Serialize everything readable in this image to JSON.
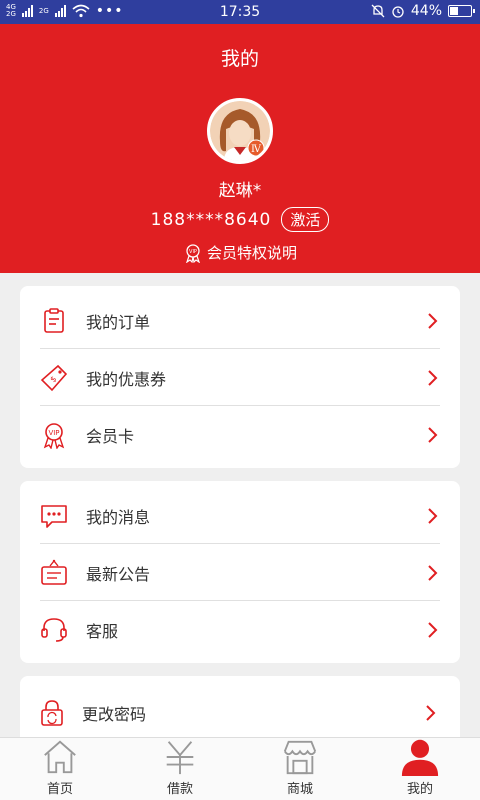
{
  "status_bar": {
    "net1": "4G",
    "net2": "2G",
    "net3": "2G",
    "time": "17:35",
    "battery": "44%",
    "battery_level": 0.44
  },
  "header": {
    "title": "我的",
    "name": "赵琳*",
    "phone": "188****8640",
    "activate_label": "激活",
    "privilege_label": "会员特权说明"
  },
  "group1": [
    {
      "label": "我的订单",
      "icon": "clipboard-icon"
    },
    {
      "label": "我的优惠券",
      "icon": "coupon-tag-icon"
    },
    {
      "label": "会员卡",
      "icon": "vip-badge-icon"
    }
  ],
  "group2": [
    {
      "label": "我的消息",
      "icon": "message-icon"
    },
    {
      "label": "最新公告",
      "icon": "notice-board-icon"
    },
    {
      "label": "客服",
      "icon": "headset-icon"
    }
  ],
  "group3": [
    {
      "label": "更改密码",
      "icon": "lock-refresh-icon"
    }
  ],
  "tabs": [
    {
      "label": "首页",
      "icon": "home-icon"
    },
    {
      "label": "借款",
      "icon": "yen-icon"
    },
    {
      "label": "商城",
      "icon": "store-icon"
    },
    {
      "label": "我的",
      "icon": "user-icon",
      "active": true
    }
  ],
  "colors": {
    "brand_red": "#e01f22",
    "status_bar": "#2f3e9e",
    "tab_active": "#e01f22",
    "tab_inactive": "#999999"
  }
}
